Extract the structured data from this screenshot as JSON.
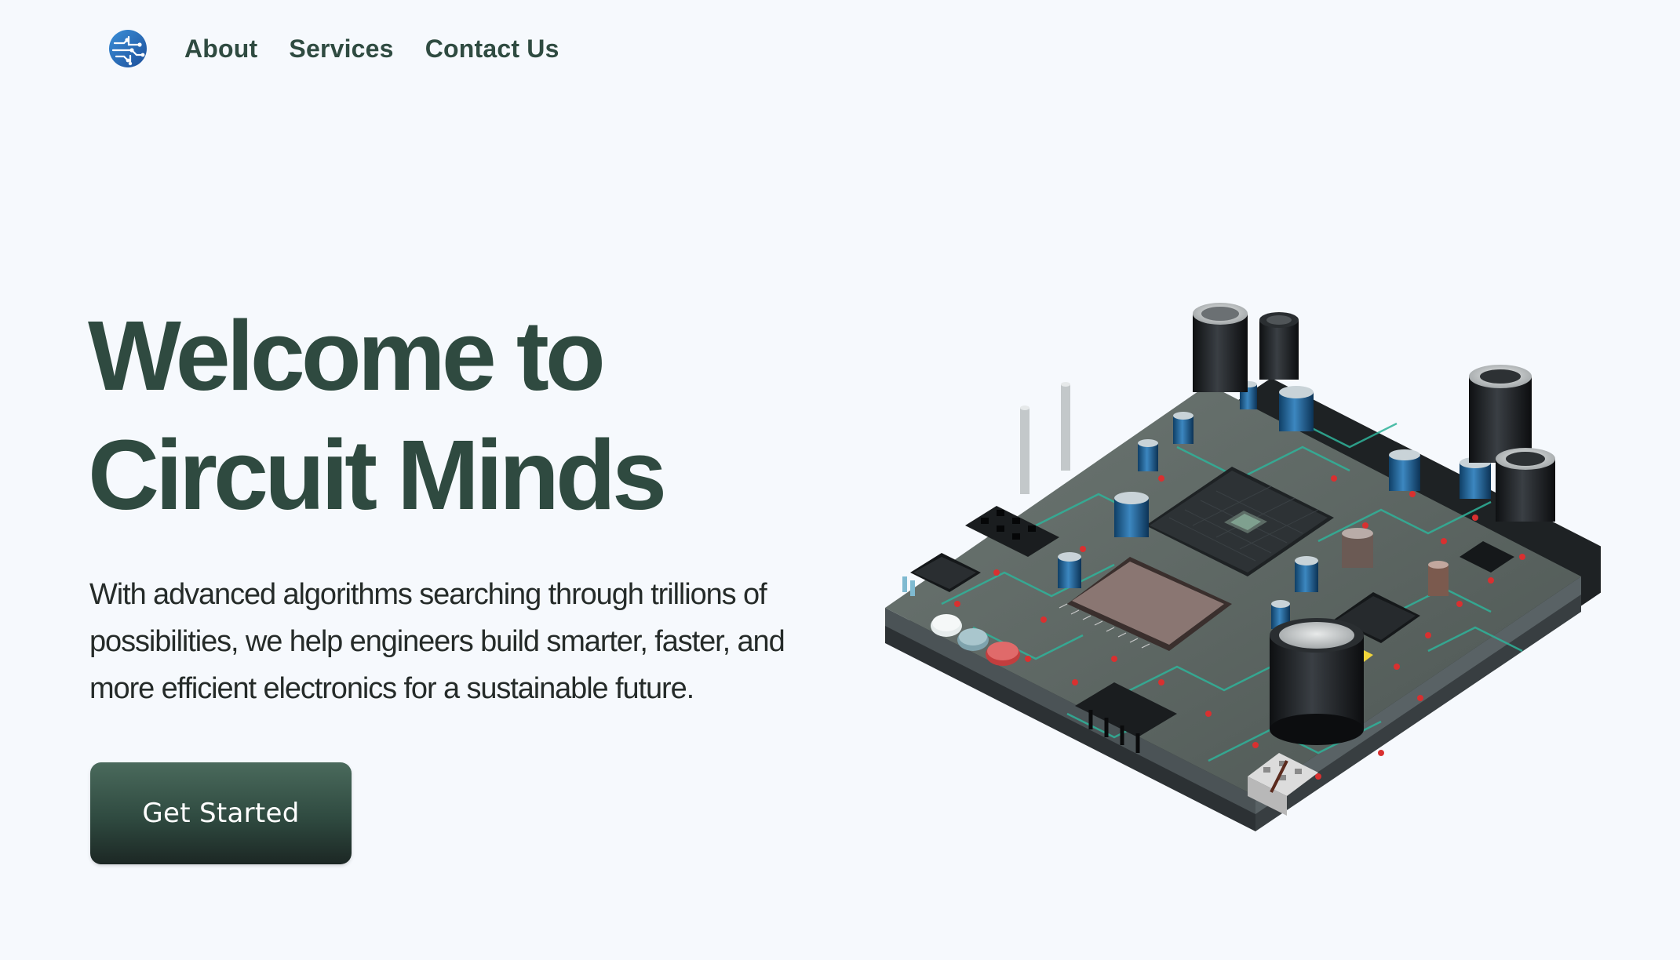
{
  "nav": {
    "logo_icon": "circuit-brain-logo",
    "links": [
      "About",
      "Services",
      "Contact Us"
    ]
  },
  "hero": {
    "title_line1": "Welcome to",
    "title_line2": "Circuit Minds",
    "description": "With advanced algorithms searching through trillions of possibilities, we help engineers build smarter, faster, and more efficient electronics for a sustainable future.",
    "cta_label": "Get Started"
  },
  "colors": {
    "background": "#f6f9fd",
    "brand_green": "#2f4a40",
    "text_dark": "#252b29",
    "logo_blue": "#2a6fb8"
  },
  "illustration": "3d-circuit-board-image"
}
